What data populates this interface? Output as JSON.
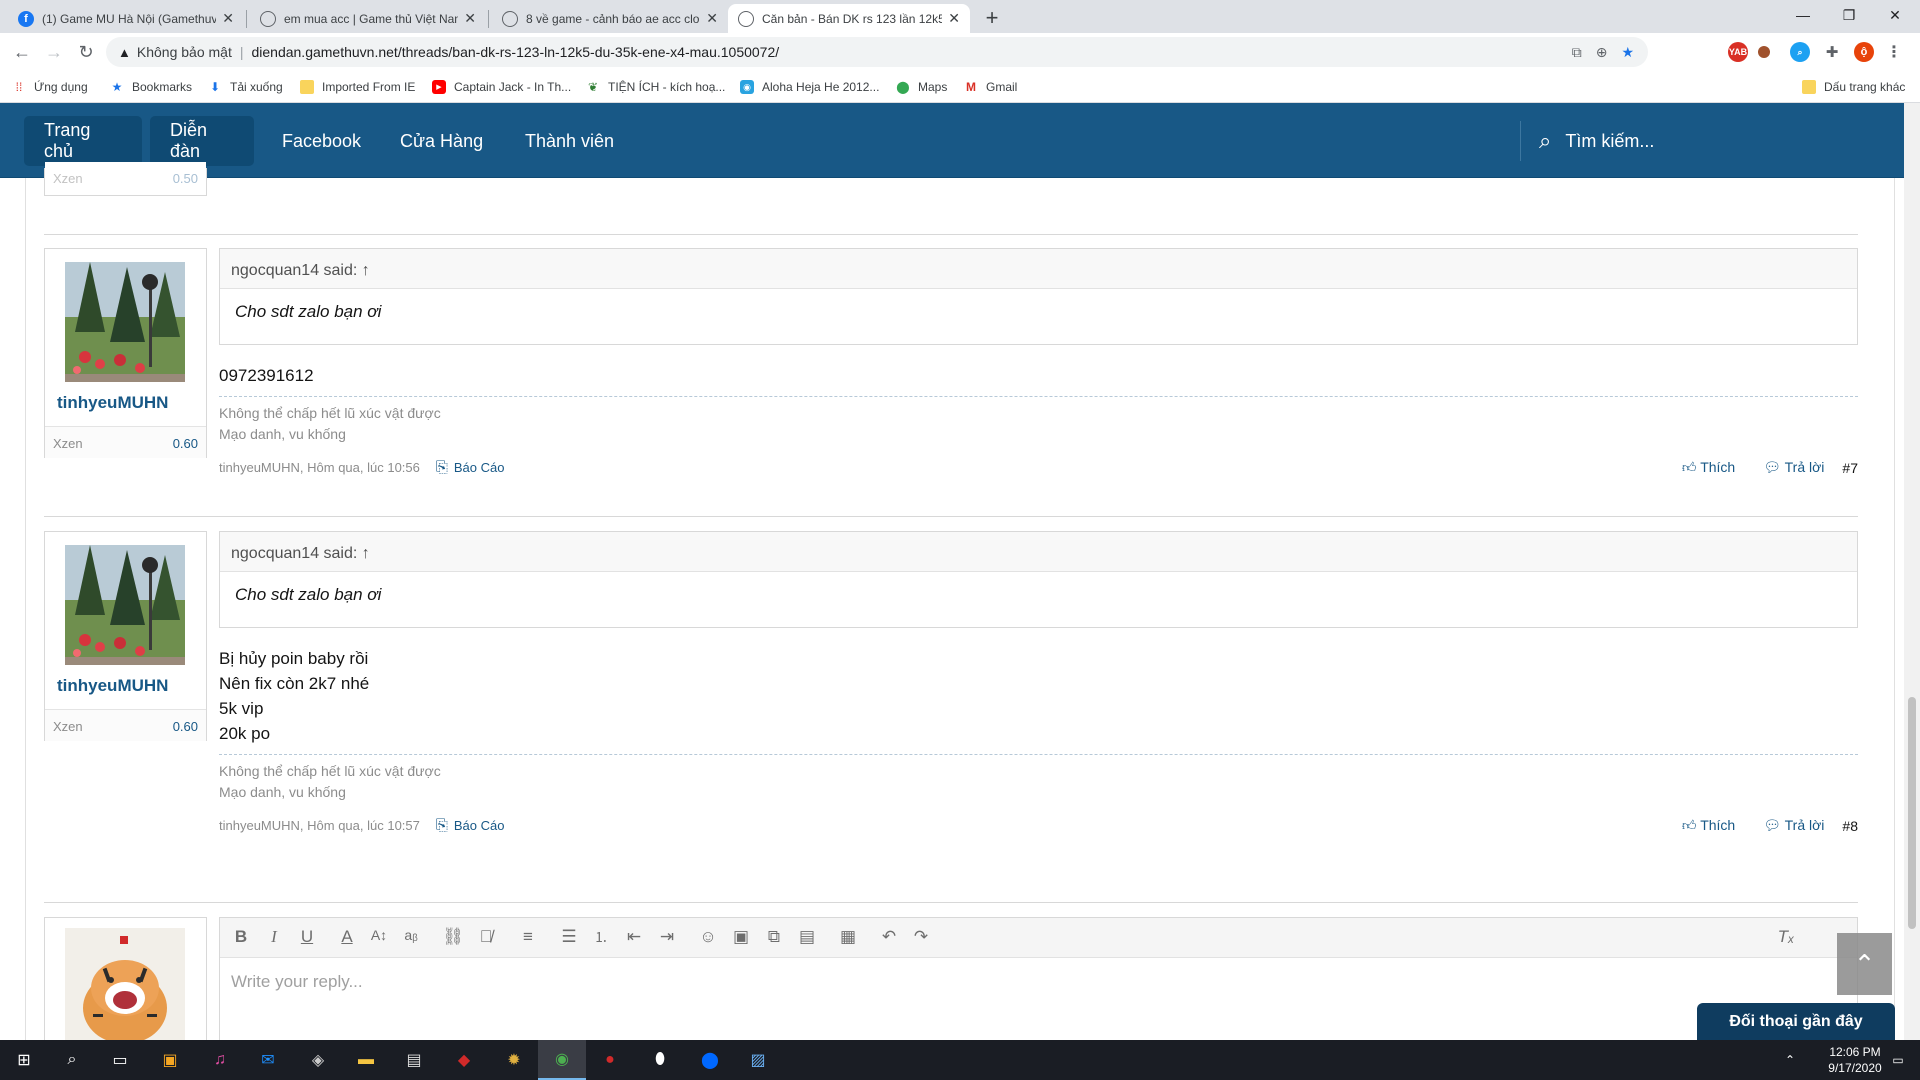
{
  "browser": {
    "tabs": [
      {
        "title": "(1) Game MU Hà Nội (Gamethuvn",
        "icon": "facebook-icon",
        "color": "#1877f2"
      },
      {
        "title": "em mua acc | Game thủ Việt Nam",
        "icon": "globe-icon",
        "color": "#5f6368"
      },
      {
        "title": "8 về game - cảnh báo ae acc clon",
        "icon": "globe-icon",
        "color": "#5f6368"
      },
      {
        "title": "Căn bản - Bán DK rs 123 lần 12k5",
        "icon": "globe-icon",
        "color": "#5f6368"
      }
    ],
    "address": {
      "security_label": "Không bảo mật",
      "url": "diendan.gamethuvn.net/threads/ban-dk-rs-123-ln-12k5-du-35k-ene-x4-mau.1050072/"
    },
    "bookmarks": [
      {
        "label": "Ứng dụng",
        "icon": "apps-grid-icon"
      },
      {
        "label": "Bookmarks",
        "icon": "star-icon"
      },
      {
        "label": "Tải xuống",
        "icon": "download-icon"
      },
      {
        "label": "Imported From IE",
        "icon": "folder-icon"
      },
      {
        "label": "Captain Jack - In Th...",
        "icon": "youtube-icon"
      },
      {
        "label": "TIỆN ÍCH - kích hoạ...",
        "icon": "leaf-icon"
      },
      {
        "label": "Aloha Heja He 2012...",
        "icon": "camera-icon"
      },
      {
        "label": "Maps",
        "icon": "maps-pin-icon"
      },
      {
        "label": "Gmail",
        "icon": "gmail-icon"
      }
    ],
    "other_bookmarks": "Dấu trang khác",
    "profile_initial": "ộ"
  },
  "site": {
    "nav": [
      "Trang chủ",
      "Diễn đàn",
      "Facebook",
      "Cửa Hàng",
      "Thành viên"
    ],
    "search_label": "Tìm kiếm..."
  },
  "prev_stat": {
    "label": "Xzen",
    "value": "0.50"
  },
  "posts": [
    {
      "username": "tinhyeuMUHN",
      "stat_label": "Xzen",
      "stat_value": "0.60",
      "quote_author": "ngocquan14 said:",
      "quote_text": "Cho sdt zalo bạn ơi",
      "lines": [
        "0972391612"
      ],
      "sig1": "Không thể chấp hết lũ xúc vật được",
      "sig2": "Mạo danh, vu khống",
      "meta": "tinhyeuMUHN, Hôm qua, lúc 10:56",
      "report": "Báo Cáo",
      "like": "Thích",
      "reply": "Trả lời",
      "number": "#7"
    },
    {
      "username": "tinhyeuMUHN",
      "stat_label": "Xzen",
      "stat_value": "0.60",
      "quote_author": "ngocquan14 said:",
      "quote_text": "Cho sdt zalo bạn ơi",
      "lines": [
        "Bị hủy poin baby rồi",
        "Nên fix còn 2k7 nhé",
        "5k vip",
        "20k po"
      ],
      "sig1": "Không thể chấp hết lũ xúc vật được",
      "sig2": "Mạo danh, vu khống",
      "meta": "tinhyeuMUHN, Hôm qua, lúc 10:57",
      "report": "Báo Cáo",
      "like": "Thích",
      "reply": "Trả lời",
      "number": "#8"
    }
  ],
  "reply_box": {
    "placeholder": "Write your reply..."
  },
  "conversations_button": "Đối thoại gần đây",
  "clock": {
    "time": "12:06 PM",
    "date": "9/17/2020"
  },
  "colors": {
    "nav_bg": "#185886",
    "nav_active": "#0f4a73",
    "link": "#185886"
  }
}
